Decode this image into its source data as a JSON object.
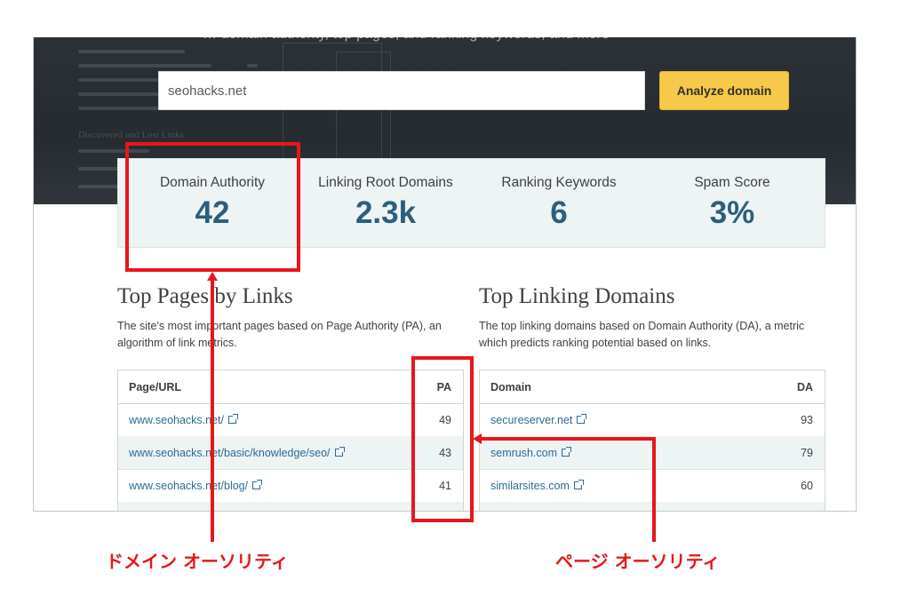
{
  "hero": {
    "header_text": "… domain authority, top pages, and ranking keywords, and more",
    "search_value": "seohacks.net",
    "analyze_label": "Analyze domain",
    "bg_decor_text": "Discovered and Lost Links"
  },
  "metrics": [
    {
      "label": "Domain Authority",
      "value": "42"
    },
    {
      "label": "Linking Root Domains",
      "value": "2.3k"
    },
    {
      "label": "Ranking Keywords",
      "value": "6"
    },
    {
      "label": "Spam Score",
      "value": "3%"
    }
  ],
  "top_pages": {
    "title": "Top Pages by Links",
    "description": "The site's most important pages based on Page Authority (PA), an algorithm of link metrics.",
    "col_url": "Page/URL",
    "col_pa": "PA",
    "rows": [
      {
        "url": "www.seohacks.net/",
        "pa": "49"
      },
      {
        "url": "www.seohacks.net/basic/knowledge/seo/",
        "pa": "43"
      },
      {
        "url": "www.seohacks.net/blog/",
        "pa": "41"
      }
    ]
  },
  "top_domains": {
    "title": "Top Linking Domains",
    "description": "The top linking domains based on Domain Authority (DA), a metric which predicts ranking potential based on links.",
    "col_domain": "Domain",
    "col_da": "DA",
    "rows": [
      {
        "domain": "secureserver.net",
        "da": "93"
      },
      {
        "domain": "semrush.com",
        "da": "79"
      },
      {
        "domain": "similarsites.com",
        "da": "60"
      }
    ]
  },
  "annotations": {
    "domain_authority": "ドメイン オーソリティ",
    "page_authority": "ページ オーソリティ",
    "color": "#e8161b"
  },
  "colors": {
    "accent_button": "#f7c94b",
    "metric_value": "#2c5f7c",
    "link": "#2c6b95",
    "hero_bg": "#2b3137"
  }
}
